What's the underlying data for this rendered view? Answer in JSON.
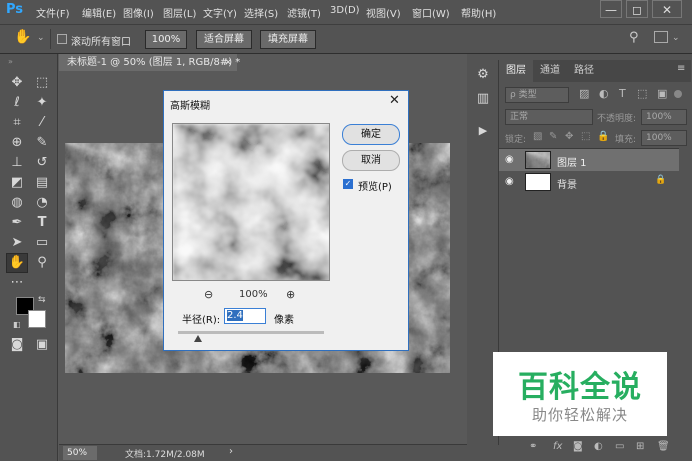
{
  "app": {
    "logo": "Ps"
  },
  "menu": [
    "文件(F)",
    "编辑(E)",
    "图像(I)",
    "图层(L)",
    "文字(Y)",
    "选择(S)",
    "滤镜(T)",
    "3D(D)",
    "视图(V)",
    "窗口(W)",
    "帮助(H)"
  ],
  "window_controls": {
    "minimize": "—",
    "restore": "◻",
    "close": "✕"
  },
  "options_bar": {
    "scroll_all_label": "滚动所有窗口",
    "zoom_btn": "100%",
    "fit_screen_btn": "适合屏幕",
    "fill_screen_btn": "填充屏幕"
  },
  "document": {
    "tab_title": "未标题-1 @ 50% (图层 1, RGB/8#) *",
    "close": "×"
  },
  "status": {
    "zoom": "50%",
    "doc_info": "文档:1.72M/2.08M",
    "arrow": "›"
  },
  "dialog": {
    "title": "高斯模糊",
    "ok": "确定",
    "cancel": "取消",
    "preview_label": "预览(P)",
    "preview_checked": true,
    "zoom_level": "100%",
    "radius_label": "半径(R):",
    "radius_value": "2.4",
    "radius_unit": "像素",
    "radius_slider_fraction": 0.14
  },
  "layers_panel": {
    "tabs": [
      "图层",
      "通道",
      "路径"
    ],
    "filter_kind": "ρ 类型",
    "blend_mode": "正常",
    "opacity_label": "不透明度:",
    "opacity_value": "100%",
    "lock_label": "锁定:",
    "fill_label": "填充:",
    "fill_value": "100%",
    "layers": [
      {
        "name": "图层 1",
        "selected": true,
        "locked": false
      },
      {
        "name": "背景",
        "selected": false,
        "locked": true
      }
    ]
  },
  "watermark": {
    "title": "百科全说",
    "subtitle": "助你轻松解决"
  },
  "colors": {
    "accent": "#31a8ff",
    "watermark_green": "#27ae60",
    "dialog_border": "#2f6fbe"
  }
}
